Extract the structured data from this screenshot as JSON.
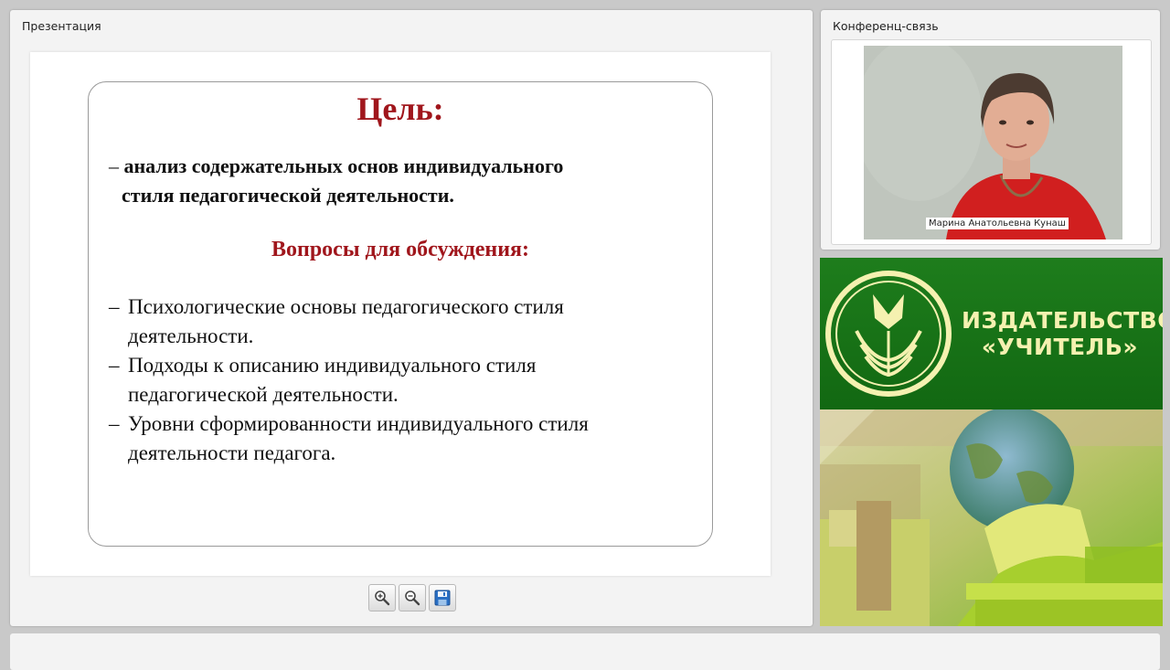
{
  "presentation": {
    "title": "Презентация",
    "slide": {
      "goal_heading": "Цель:",
      "goal_dash": "–",
      "goal_line1": "анализ содержательных основ индивидуального",
      "goal_line2": "стиля педагогической деятельности.",
      "questions_heading": "Вопросы для обсуждения:",
      "questions": [
        {
          "dash": "–",
          "line1": "Психологические основы педагогического стиля",
          "line2": "деятельности."
        },
        {
          "dash": "–",
          "line1": "Подходы к описанию индивидуального стиля",
          "line2": "педагогической деятельности."
        },
        {
          "dash": "–",
          "line1": "Уровни сформированности индивидуального стиля",
          "line2": "деятельности педагога."
        }
      ]
    },
    "toolbar": {
      "zoom_in_icon": "zoom-in-icon",
      "zoom_out_icon": "zoom-out-icon",
      "save_icon": "save-icon"
    }
  },
  "conference": {
    "title": "Конференц-связь",
    "speaker_name": "Марина Анатольевна Кунаш"
  },
  "ad": {
    "publisher_line1": "ИЗДАТЕЛЬСТВО",
    "publisher_line2": "«УЧИТЕЛЬ»"
  },
  "colors": {
    "heading_red": "#a0161c",
    "brand_green": "#1e7d1c",
    "brand_yellow": "#f5f1b0"
  }
}
